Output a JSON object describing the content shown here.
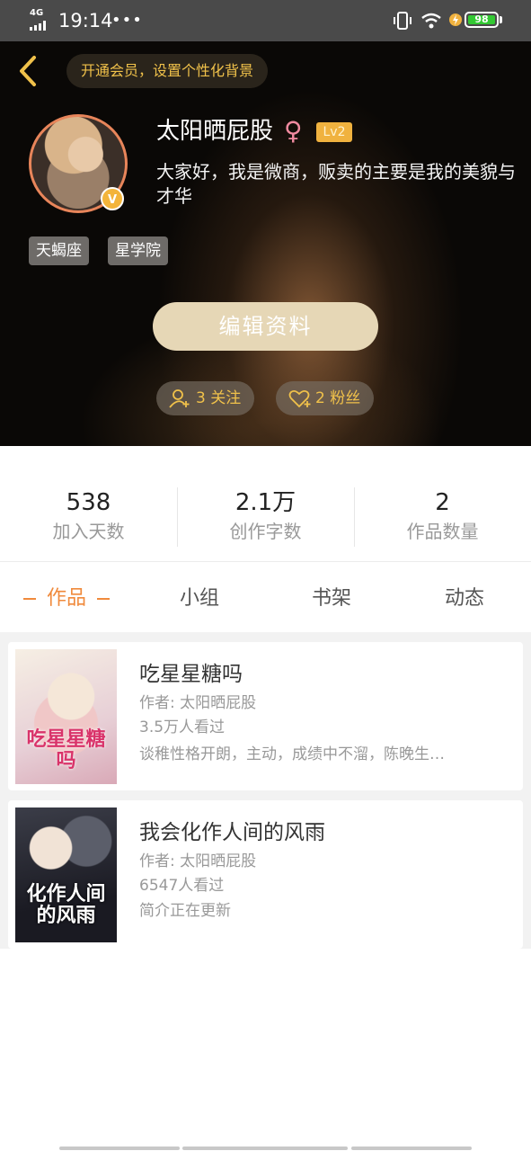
{
  "status_bar": {
    "network": "4G",
    "time": "19:14",
    "dots": "•••",
    "battery": "98"
  },
  "header": {
    "back_icon": "chevron-left-icon",
    "vip_banner": "开通会员，设置个性化背景",
    "username": "太阳晒屁股",
    "gender_symbol": "♀",
    "level": "Lv2",
    "verified_badge": "V",
    "bio": "大家好，我是微商，贩卖的主要是我的美貌与才华",
    "tags": [
      "天蝎座",
      "星学院"
    ],
    "edit_button": "编辑资料",
    "following": "3 关注",
    "followers": "2 粉丝"
  },
  "stats": [
    {
      "value": "538",
      "label": "加入天数"
    },
    {
      "value": "2.1万",
      "label": "创作字数"
    },
    {
      "value": "2",
      "label": "作品数量"
    }
  ],
  "tabs": [
    "作品",
    "小组",
    "书架",
    "动态"
  ],
  "active_tab": "作品",
  "works": [
    {
      "title": "吃星星糖吗",
      "author": "作者: 太阳晒屁股",
      "views": "3.5万人看过",
      "description": "谈稚性格开朗，主动，成绩中不溜，陈晚生…",
      "cover_text": "吃星星糖吗"
    },
    {
      "title": "我会化作人间的风雨",
      "author": "作者: 太阳晒屁股",
      "views": "6547人看过",
      "description": "简介正在更新",
      "cover_text": "化作人间的风雨"
    }
  ],
  "colors": {
    "accent": "#f08a3c",
    "gold": "#f0c14a",
    "level_badge": "#f0b23f",
    "edit_button": "#e6d7b6"
  }
}
